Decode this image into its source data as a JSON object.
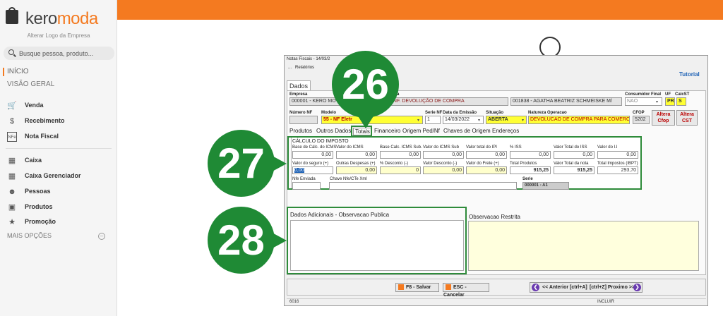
{
  "brand": {
    "name_part1": "kero",
    "name_part2": "moda",
    "alter_logo": "Alterar Logo da Empresa",
    "accent": "#f47a20"
  },
  "search": {
    "placeholder": "Busque pessoa, produto..."
  },
  "nav": {
    "inicio": "INÍCIO",
    "visao_geral": "VISÃO GERAL",
    "items": [
      {
        "label": "Venda",
        "icon": "cart-icon"
      },
      {
        "label": "Recebimento",
        "icon": "money-icon"
      },
      {
        "label": "Nota Fiscal",
        "icon": "nfe-icon"
      },
      {
        "label": "Caixa",
        "icon": "cash-register-icon"
      },
      {
        "label": "Caixa Gerenciador",
        "icon": "cash-manager-icon"
      },
      {
        "label": "Pessoas",
        "icon": "people-icon"
      },
      {
        "label": "Produtos",
        "icon": "box-icon"
      },
      {
        "label": "Promoção",
        "icon": "tag-icon"
      }
    ],
    "mais_opcoes": "MAIS OPÇÕES"
  },
  "window": {
    "title": "Notas Fiscais - 14/03/2",
    "menu_dots": "...",
    "menu_relatorios": "Relatórios",
    "tutorial": "Tutorial",
    "tab_dados": "Dados"
  },
  "header": {
    "empresa_label": "Empresa",
    "empresa_value": "000001 - KERO MO",
    "nota_label": "Nota",
    "nota_value": "012 - NF. DEVOLUÇÃO DE COMPRA",
    "pessoa_value": "001838 - AGATHA BEATRIZ SCHMEISKE M/",
    "consumidor_label": "Consumidor Final",
    "consumidor_value": "NAO",
    "uf_label": "UF",
    "uf_value": "PR",
    "calcst_label": "CalcST",
    "calcst_value": "S",
    "numero_nf_label": "Número NF",
    "numero_nf_value": "",
    "modelo_label": "Modelo",
    "modelo_value": "55 - NF Eletr",
    "serie_label": "Serie NF",
    "serie_value": "1",
    "data_label": "Data da Emissão",
    "data_value": "14/03/2022",
    "situacao_label": "Situação",
    "situacao_value": "ABERTA",
    "natureza_label": "Natureza Operacao",
    "natureza_value": "DEVOLUCAO DE COMPRA PARA COMERCI",
    "cfop_label": "CFOP",
    "cfop_value": "5202",
    "altera_cfop": "Altera Cfop",
    "altera_cst": "Altera CST"
  },
  "subtabs": [
    "Produtos",
    "Outros Dados",
    "Totais",
    "Financeiro",
    "Origem Ped/Nf",
    "Chaves de Origem",
    "Endereços"
  ],
  "totais": {
    "section_title": "CÁLCULO DO IMPOSTO",
    "row1": [
      {
        "label": "Base de Cálc. do ICMS",
        "value": "0,00"
      },
      {
        "label": "Valor do ICMS",
        "value": "0,00"
      },
      {
        "label": "Base Calc. ICMS Sub.",
        "value": "0,00"
      },
      {
        "label": "Valor do ICMS Sub",
        "value": "0,00"
      },
      {
        "label": "Valor total do IPI",
        "value": "0,00"
      },
      {
        "label": "% ISS",
        "value": "0,00"
      },
      {
        "label": "Valor Total do ISS",
        "value": "0,00"
      },
      {
        "label": "Valor do I.I",
        "value": "0,00"
      }
    ],
    "row2": [
      {
        "label": "Valor do seguro (+)",
        "value": "0,00"
      },
      {
        "label": "Outras Despesas (+)",
        "value": "0,00"
      },
      {
        "label": "% Desconto (-)",
        "value": "0"
      },
      {
        "label": "Valor Desconto (-)",
        "value": "0,00"
      },
      {
        "label": "Valor do Frete (+)",
        "value": "0,00"
      },
      {
        "label": "Total Produtos",
        "value": "915,25"
      },
      {
        "label": "Valor Total da nota",
        "value": "915,25"
      },
      {
        "label": "Total Impostos (IBPT)",
        "value": "293,70"
      }
    ],
    "nfe_enviada_label": "Nfe Enviada",
    "chave_label": "Chave Nfe/CTe Xml",
    "serie_label": "Serie",
    "serie_value": "000001 - A1"
  },
  "obs": {
    "publica_label": "Dados Adicionais - Observacao Publica",
    "restrita_label": "Observacao Restrita"
  },
  "buttons": {
    "salvar": "F8 - Salvar",
    "cancelar": "ESC - Cancelar",
    "anterior": "<< Anterior [ctrl+A]",
    "proximo": "[ctrl+Z] Proximo >>"
  },
  "status": {
    "left": "6016",
    "right": "INCLUIR"
  },
  "badges": {
    "b26": "26",
    "b27": "27",
    "b28": "28",
    "color": "#1f8a35"
  }
}
